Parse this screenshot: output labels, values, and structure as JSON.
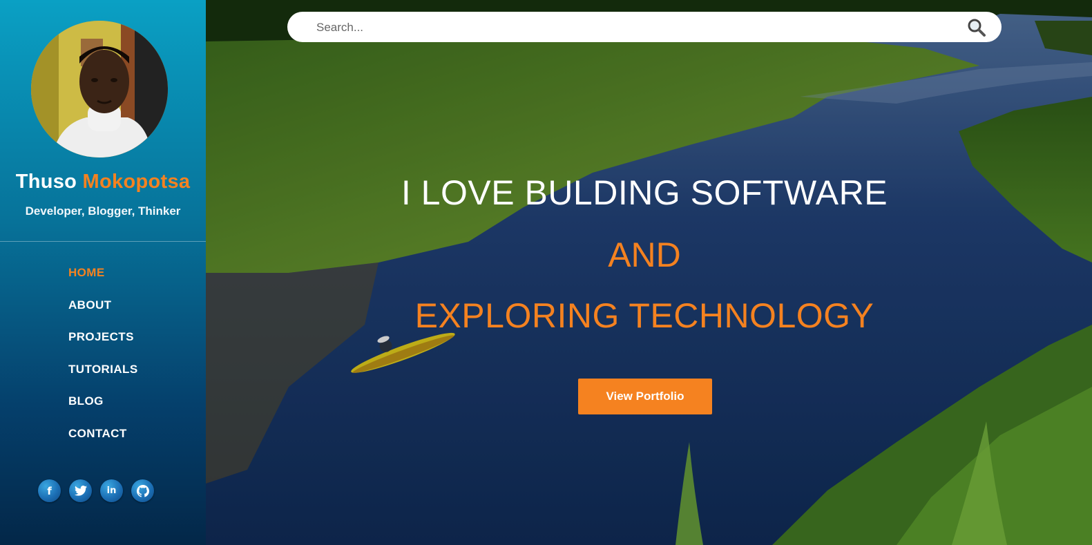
{
  "colors": {
    "accent": "#f58220",
    "sidebar_top": "#0aa0c4",
    "sidebar_bottom": "#032748"
  },
  "profile": {
    "first_name": "Thuso",
    "last_name": "Mokopotsa",
    "tagline": "Developer, Blogger, Thinker"
  },
  "nav": {
    "items": [
      {
        "label": "HOME",
        "active": true
      },
      {
        "label": "ABOUT"
      },
      {
        "label": "PROJECTS"
      },
      {
        "label": "TUTORIALS"
      },
      {
        "label": "BLOG"
      },
      {
        "label": "CONTACT"
      }
    ]
  },
  "social": [
    {
      "icon": "facebook-icon",
      "glyph": "f"
    },
    {
      "icon": "twitter-icon",
      "glyph": "🐦"
    },
    {
      "icon": "linkedin-icon",
      "glyph": "in"
    },
    {
      "icon": "github-icon",
      "glyph": ""
    }
  ],
  "search": {
    "placeholder": "Search...",
    "value": ""
  },
  "hero": {
    "line1": "I LOVE BULDING SOFTWARE",
    "line2": "AND",
    "line3": "EXPLORING TECHNOLOGY",
    "cta_label": "View Portfolio"
  }
}
